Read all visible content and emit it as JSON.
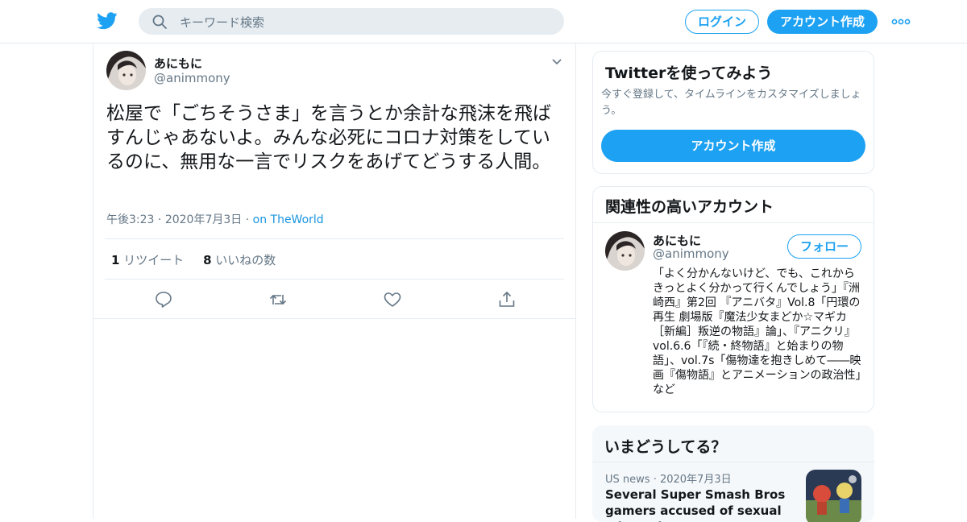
{
  "header": {
    "search_placeholder": "キーワード検索",
    "login_label": "ログイン",
    "signup_label": "アカウント作成"
  },
  "tweet": {
    "author_name": "あにもに",
    "author_handle": "@animmony",
    "text": "松屋で「ごちそうさま」を言うとか余計な飛沫を飛ばすんじゃあないよ。みんな必死にコロナ対策をしているのに、無用な一言でリスクをあげてどうする人間。",
    "time": "午後3:23",
    "date": "2020年7月3日",
    "source": "on TheWorld",
    "separator": "·",
    "retweet_count": "1",
    "retweet_label": "リツイート",
    "like_count": "8",
    "like_label": "いいねの数"
  },
  "sidebar": {
    "signup_card": {
      "title": "Twitterを使ってみよう",
      "description": "今すぐ登録して、タイムラインをカスタマイズしましょう。",
      "button_label": "アカウント作成"
    },
    "related_card": {
      "title": "関連性の高いアカウント",
      "account": {
        "name": "あにもに",
        "handle": "@animmony",
        "follow_label": "フォロー",
        "bio": "「よく分かんないけど、でも、これからきっとよく分かって行くんでしょう」『洲崎西』第2回 『アニバタ』Vol.8「円環の再生 劇場版『魔法少女まどか☆マギカ［新編］叛逆の物語』論」、『アニクリ』vol.6.6「『続・終物語』と始まりの物語」、vol.7s「傷物達を抱きしめて――映画『傷物語』とアニメーションの政治性」など"
      }
    },
    "trends_card": {
      "title": "いまどうしてる？",
      "trend": {
        "category": "US news",
        "separator": "·",
        "date": "2020年7月3日",
        "title": "Several Super Smash Bros gamers accused of sexual misconduct"
      }
    }
  },
  "colors": {
    "brand": "#1da1f2",
    "link": "#1b95e0",
    "secondary_text": "#657786",
    "border": "#e6ecf0"
  },
  "icons": [
    "twitter-bird-icon",
    "search-icon",
    "more-dots-icon",
    "chevron-down-icon",
    "reply-icon",
    "retweet-icon",
    "like-heart-icon",
    "share-icon"
  ]
}
